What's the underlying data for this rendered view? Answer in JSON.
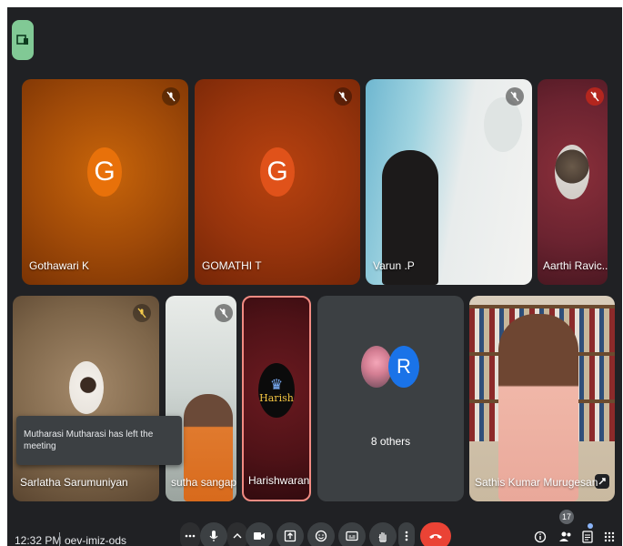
{
  "participants": {
    "gothawari": {
      "name": "Gothawari K",
      "initial": "G"
    },
    "gomathi": {
      "name": "GOMATHI T",
      "initial": "G"
    },
    "varun": {
      "name": "Varun .P"
    },
    "aarthi": {
      "name": "Aarthi Ravic..."
    },
    "sarlatha": {
      "name": "Sarlatha Sarumuniyan"
    },
    "sutha": {
      "name": "sutha sangap..."
    },
    "harishwaran": {
      "name": "Harishwaran",
      "logo_text": "Harish"
    },
    "others": {
      "label": "8 others",
      "initial": "R"
    },
    "sathis": {
      "name": "Sathis Kumar Murugesan"
    }
  },
  "toast": {
    "message": "Mutharasi Mutharasi has left the meeting"
  },
  "footer": {
    "time": "12:32 PM",
    "meeting_code": "oev-imiz-ods",
    "people_count": "17"
  },
  "colors": {
    "accent": "#81c995",
    "end_call": "#ea4335",
    "avatar_orange": "#e8710a",
    "avatar_blue": "#1a73e8"
  },
  "icons": [
    "layout-icon",
    "mic-off-icon",
    "mic-icon",
    "camera-icon",
    "present-icon",
    "emoji-icon",
    "captions-icon",
    "raise-hand-icon",
    "more-icon",
    "end-call-icon",
    "info-icon",
    "people-icon",
    "chat-icon",
    "activities-icon"
  ]
}
